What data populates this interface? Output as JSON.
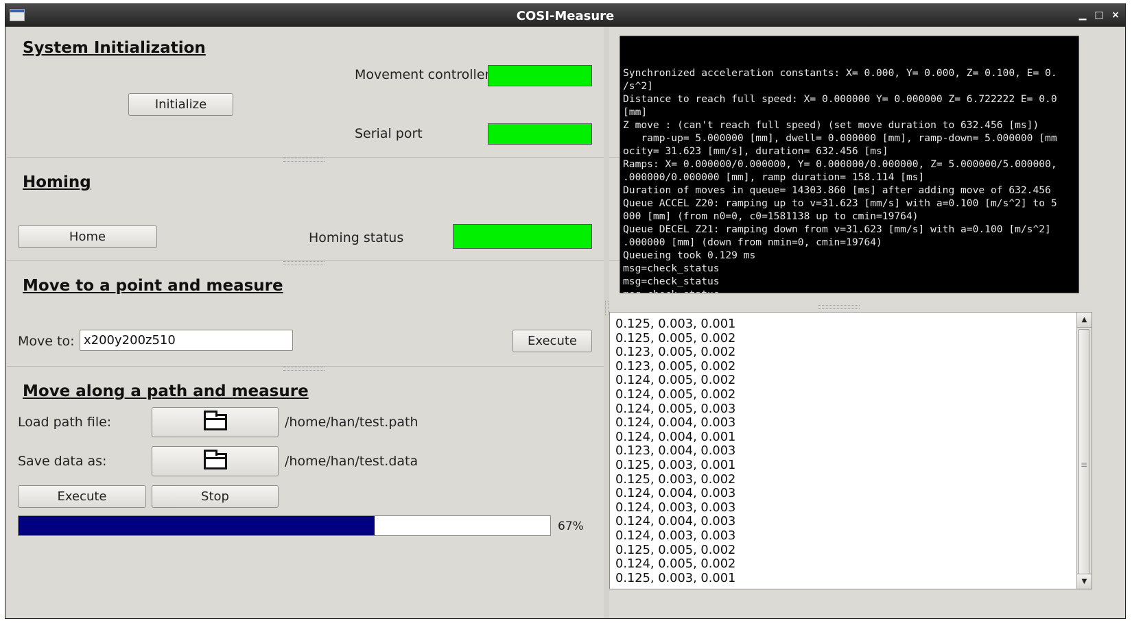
{
  "window": {
    "title": "COSI-Measure",
    "controls": {
      "minimize": "▁",
      "maximize": "□",
      "close": "×"
    }
  },
  "system_init": {
    "title": "System Initialization",
    "initialize_label": "Initialize",
    "movement_controller_label": "Movement controller",
    "serial_port_label": "Serial port",
    "status_color": "#00f000"
  },
  "homing": {
    "title": "Homing",
    "home_label": "Home",
    "status_label": "Homing status"
  },
  "move_point": {
    "title": "Move to a point and measure",
    "move_to_label": "Move to:",
    "move_to_value": "x200y200z510",
    "execute_label": "Execute"
  },
  "move_path": {
    "title": "Move along a path and measure",
    "load_label": "Load path file:",
    "load_path": "/home/han/test.path",
    "save_label": "Save data as:",
    "save_path": "/home/han/test.data",
    "execute_label": "Execute",
    "stop_label": "Stop",
    "progress": 67,
    "progress_text": "67%"
  },
  "console": {
    "lines": [
      "Synchronized acceleration constants: X= 0.000, Y= 0.000, Z= 0.100, E= 0.",
      "/s^2]",
      "Distance to reach full speed: X= 0.000000 Y= 0.000000 Z= 6.722222 E= 0.0",
      "[mm]",
      "Z move : (can't reach full speed) (set move duration to 632.456 [ms])",
      "   ramp-up= 5.000000 [mm], dwell= 0.000000 [mm], ramp-down= 5.000000 [mm",
      "ocity= 31.623 [mm/s], duration= 632.456 [ms]",
      "Ramps: X= 0.000000/0.000000, Y= 0.000000/0.000000, Z= 5.000000/5.000000,",
      ".000000/0.000000 [mm], ramp duration= 158.114 [ms]",
      "Duration of moves in queue= 14303.860 [ms] after adding move of 632.456",
      "Queue ACCEL Z20: ramping up to v=31.623 [mm/s] with a=0.100 [m/s^2] to 5",
      "000 [mm] (from n0=0, c0=1581138 up to cmin=19764)",
      "Queue DECEL Z21: ramping down from v=31.623 [mm/s] with a=0.100 [m/s^2]",
      ".000000 [mm] (down from nmin=0, cmin=19764)",
      "Queueing took 0.129 ms",
      "msg=check_status",
      "msg=check_status",
      "msg=check_status"
    ]
  },
  "data_output": {
    "rows": [
      "0.125, 0.003, 0.001",
      "0.125, 0.005, 0.002",
      "0.123, 0.005, 0.002",
      "0.123, 0.005, 0.002",
      "0.124, 0.005, 0.002",
      "0.124, 0.005, 0.002",
      "0.124, 0.005, 0.003",
      "0.124, 0.004, 0.003",
      "0.124, 0.004, 0.001",
      "0.123, 0.004, 0.003",
      "0.125, 0.003, 0.001",
      "0.125, 0.003, 0.002",
      "0.124, 0.004, 0.003",
      "0.124, 0.003, 0.003",
      "0.124, 0.004, 0.003",
      "0.124, 0.003, 0.003",
      "0.125, 0.005, 0.002",
      "0.124, 0.005, 0.002",
      "0.125, 0.003, 0.001"
    ]
  }
}
